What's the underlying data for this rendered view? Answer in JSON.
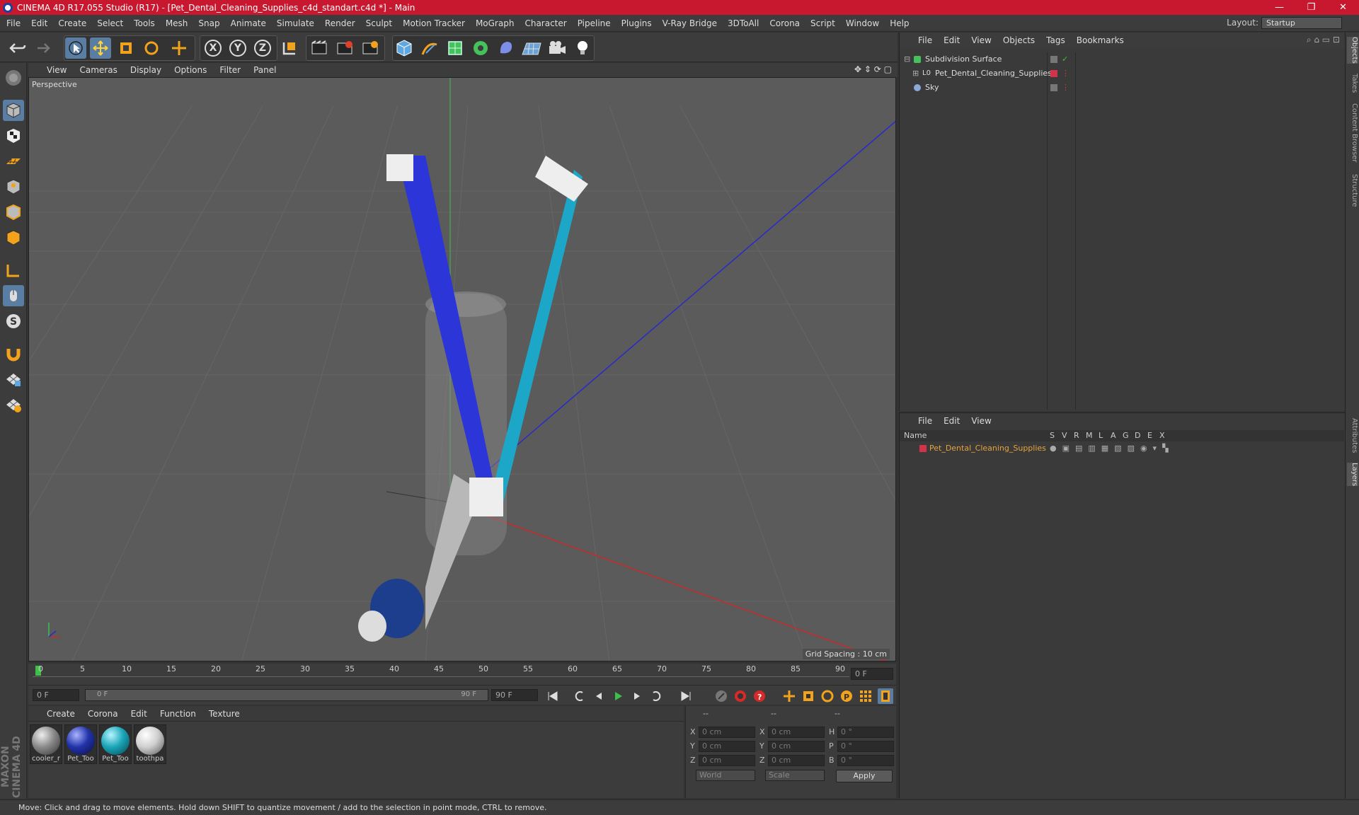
{
  "window": {
    "title": "CINEMA 4D R17.055 Studio (R17) - [Pet_Dental_Cleaning_Supplies_c4d_standart.c4d *] - Main",
    "minimize": "—",
    "maximize": "❐",
    "close": "✕"
  },
  "menubar": {
    "items": [
      "File",
      "Edit",
      "Create",
      "Select",
      "Tools",
      "Mesh",
      "Snap",
      "Animate",
      "Simulate",
      "Render",
      "Sculpt",
      "Motion Tracker",
      "MoGraph",
      "Character",
      "Pipeline",
      "Plugins",
      "V-Ray Bridge",
      "3DToAll",
      "Corona",
      "Script",
      "Window",
      "Help"
    ],
    "layout_label": "Layout:",
    "layout_value": "Startup"
  },
  "toolbar": {
    "icons": [
      "undo-icon",
      "redo-icon",
      "pointer-icon",
      "move-icon",
      "scale-icon",
      "rotate-icon",
      "live-select-icon",
      "x-axis-icon",
      "y-axis-icon",
      "z-axis-icon",
      "world-coords-icon",
      "render-view-icon",
      "render-picture-icon",
      "render-settings-icon",
      "cube-icon",
      "pen-icon",
      "subdivision-icon",
      "cloner-icon",
      "deformer-icon",
      "floor-icon",
      "camera-icon",
      "light-icon"
    ],
    "axis_x": "X",
    "axis_y": "Y",
    "axis_z": "Z"
  },
  "viewport": {
    "menu": [
      "View",
      "Cameras",
      "Display",
      "Options",
      "Filter",
      "Panel"
    ],
    "label": "Perspective",
    "grid_spacing": "Grid Spacing : 10 cm"
  },
  "timeline": {
    "ticks": [
      "0",
      "5",
      "10",
      "15",
      "20",
      "25",
      "30",
      "35",
      "40",
      "45",
      "50",
      "55",
      "60",
      "65",
      "70",
      "75",
      "80",
      "85",
      "90"
    ],
    "end_field": "0 F",
    "current_frame": "0 F",
    "range_start": "0 F",
    "range_end": "90 F",
    "end_frame": "90 F"
  },
  "materials": {
    "menu": [
      "Create",
      "Corona",
      "Edit",
      "Function",
      "Texture"
    ],
    "items": [
      {
        "label": "cooler_r",
        "color": "#8a8a8a"
      },
      {
        "label": "Pet_Too",
        "color": "#2233aa"
      },
      {
        "label": "Pet_Too",
        "color": "#1aa6b8"
      },
      {
        "label": "toothpa",
        "color": "#cfcfcf"
      }
    ]
  },
  "coordinates": {
    "header": [
      "--",
      "--",
      "--"
    ],
    "rows": [
      {
        "a": "X",
        "av": "0 cm",
        "b": "X",
        "bv": "0 cm",
        "c": "H",
        "cv": "0 °"
      },
      {
        "a": "Y",
        "av": "0 cm",
        "b": "Y",
        "bv": "0 cm",
        "c": "P",
        "cv": "0 °"
      },
      {
        "a": "Z",
        "av": "0 cm",
        "b": "Z",
        "bv": "0 cm",
        "c": "B",
        "cv": "0 °"
      }
    ],
    "world": "World",
    "scale": "Scale",
    "apply": "Apply"
  },
  "objects_panel": {
    "menu": [
      "File",
      "Edit",
      "View",
      "Objects",
      "Tags",
      "Bookmarks"
    ],
    "items": [
      {
        "name": "Subdivision Surface",
        "indent": 0
      },
      {
        "name": "Pet_Dental_Cleaning_Supplies",
        "indent": 1
      },
      {
        "name": "Sky",
        "indent": 0
      }
    ]
  },
  "layers_panel": {
    "menu": [
      "File",
      "Edit",
      "View"
    ],
    "col_name": "Name",
    "cols": [
      "S",
      "V",
      "R",
      "M",
      "L",
      "A",
      "G",
      "D",
      "E",
      "X"
    ],
    "row": "Pet_Dental_Cleaning_Supplies"
  },
  "right_tabs": [
    "Objects",
    "Takes",
    "Content Browser",
    "Structure",
    "Attributes",
    "Layers"
  ],
  "status": "Move: Click and drag to move elements. Hold down SHIFT to quantize movement / add to the selection in point mode, CTRL to remove.",
  "brand": "MAXON CINEMA 4D",
  "colors": {
    "accent": "#c8182f",
    "selected": "#5a7ea3",
    "layer_name": "#e8a23a"
  }
}
